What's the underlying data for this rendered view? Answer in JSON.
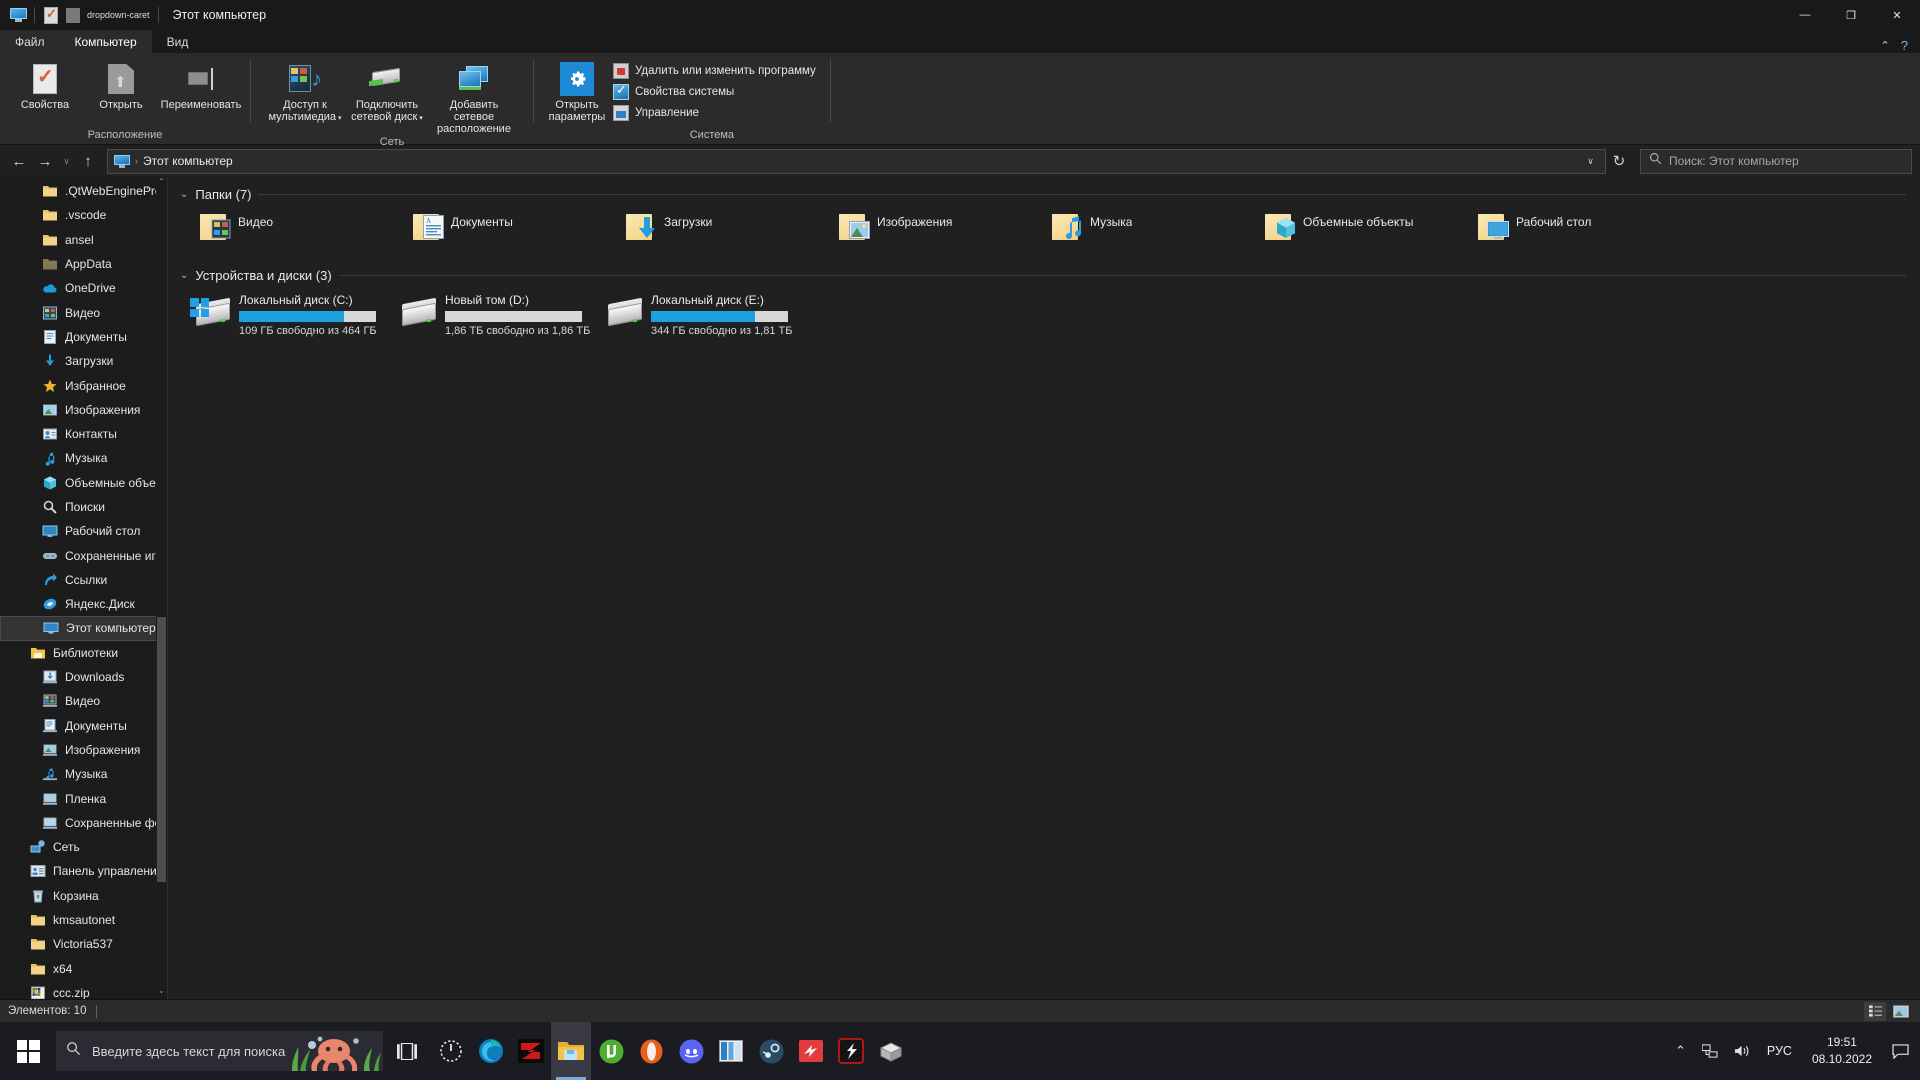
{
  "window": {
    "title": "Этот компьютер",
    "quick_access": [
      "this-pc-icon",
      "properties-icon",
      "grey-icon",
      "dropdown-caret"
    ],
    "controls": {
      "minimize": "—",
      "maximize": "❐",
      "close": "✕"
    }
  },
  "ribbon": {
    "tabs": [
      {
        "label": "Файл",
        "id": "file"
      },
      {
        "label": "Компьютер",
        "id": "computer",
        "active": true
      },
      {
        "label": "Вид",
        "id": "view"
      }
    ],
    "collapse_caret": "⌃",
    "help": "?",
    "groups": [
      {
        "label": "Расположение",
        "buttons": [
          {
            "label": "Свойства",
            "icon": "properties-icon",
            "has_dropdown": false
          },
          {
            "label": "Открыть",
            "icon": "open-icon",
            "has_dropdown": false
          },
          {
            "label": "Переименовать",
            "icon": "rename-icon",
            "has_dropdown": false
          }
        ]
      },
      {
        "label": "Сеть",
        "buttons": [
          {
            "label": "Доступ к мультимедиа",
            "icon": "media-server-icon",
            "has_dropdown": true
          },
          {
            "label": "Подключить сетевой диск",
            "icon": "map-network-drive-icon",
            "has_dropdown": true
          },
          {
            "label": "Добавить сетевое расположение",
            "icon": "add-network-location-icon",
            "has_dropdown": false
          }
        ]
      },
      {
        "label": "Система",
        "buttons": [
          {
            "label": "Открыть параметры",
            "icon": "settings-gear-icon",
            "has_dropdown": false
          }
        ],
        "small_buttons": [
          {
            "label": "Удалить или изменить программу",
            "icon": "uninstall-icon"
          },
          {
            "label": "Свойства системы",
            "icon": "system-properties-icon"
          },
          {
            "label": "Управление",
            "icon": "manage-icon"
          }
        ]
      }
    ]
  },
  "nav": {
    "back": "←",
    "forward": "→",
    "recent": "∨",
    "up": "↑",
    "address_icon": "this-pc-icon",
    "address_separator": "›",
    "address_text": "Этот компьютер",
    "address_dropdown": "∨",
    "refresh": "↻"
  },
  "search": {
    "icon": "search-icon",
    "placeholder": "Поиск: Этот компьютер",
    "value": ""
  },
  "sidebar": {
    "items": [
      {
        "label": ".QtWebEngineProc",
        "icon": "folder-icon",
        "indent": 1
      },
      {
        "label": ".vscode",
        "icon": "folder-icon",
        "indent": 1
      },
      {
        "label": "ansel",
        "icon": "folder-icon",
        "indent": 1
      },
      {
        "label": "AppData",
        "icon": "folder-hidden-icon",
        "indent": 1
      },
      {
        "label": "OneDrive",
        "icon": "onedrive-icon",
        "indent": 1
      },
      {
        "label": "Видео",
        "icon": "videos-icon",
        "indent": 1
      },
      {
        "label": "Документы",
        "icon": "documents-icon",
        "indent": 1
      },
      {
        "label": "Загрузки",
        "icon": "downloads-icon",
        "indent": 1
      },
      {
        "label": "Избранное",
        "icon": "favorites-star-icon",
        "indent": 1
      },
      {
        "label": "Изображения",
        "icon": "pictures-icon",
        "indent": 1
      },
      {
        "label": "Контакты",
        "icon": "contacts-icon",
        "indent": 1
      },
      {
        "label": "Музыка",
        "icon": "music-icon",
        "indent": 1
      },
      {
        "label": "Объемные объект",
        "icon": "3d-objects-icon",
        "indent": 1
      },
      {
        "label": "Поиски",
        "icon": "searches-icon",
        "indent": 1
      },
      {
        "label": "Рабочий стол",
        "icon": "desktop-icon",
        "indent": 1
      },
      {
        "label": "Сохраненные игр",
        "icon": "saved-games-icon",
        "indent": 1
      },
      {
        "label": "Ссылки",
        "icon": "links-icon",
        "indent": 1
      },
      {
        "label": "Яндекс.Диск",
        "icon": "yandex-disk-icon",
        "indent": 1
      },
      {
        "label": "Этот компьютер",
        "icon": "this-pc-icon",
        "indent": 1,
        "selected": true
      },
      {
        "label": "Библиотеки",
        "icon": "libraries-icon",
        "indent": 0
      },
      {
        "label": "Downloads",
        "icon": "library-downloads-icon",
        "indent": 1
      },
      {
        "label": "Видео",
        "icon": "library-videos-icon",
        "indent": 1
      },
      {
        "label": "Документы",
        "icon": "library-documents-icon",
        "indent": 1
      },
      {
        "label": "Изображения",
        "icon": "library-pictures-icon",
        "indent": 1
      },
      {
        "label": "Музыка",
        "icon": "library-music-icon",
        "indent": 1
      },
      {
        "label": "Пленка",
        "icon": "library-camera-roll-icon",
        "indent": 1
      },
      {
        "label": "Сохраненные фот",
        "icon": "library-saved-pictures-icon",
        "indent": 1
      },
      {
        "label": "Сеть",
        "icon": "network-icon",
        "indent": 0
      },
      {
        "label": "Панель управления",
        "icon": "control-panel-icon",
        "indent": 0
      },
      {
        "label": "Корзина",
        "icon": "recycle-bin-icon",
        "indent": 0
      },
      {
        "label": "kmsautonet",
        "icon": "folder-icon",
        "indent": 0
      },
      {
        "label": "Victoria537",
        "icon": "folder-icon",
        "indent": 0
      },
      {
        "label": "x64",
        "icon": "folder-icon",
        "indent": 0
      },
      {
        "label": "ccc.zip",
        "icon": "archive-icon",
        "indent": 0
      }
    ],
    "scroll_up": "⌃",
    "scroll_down": "⌄"
  },
  "main": {
    "groups": [
      {
        "title": "Папки (7)",
        "chevron": "⌄",
        "type": "folders",
        "items": [
          {
            "label": "Видео",
            "icon": "folder-videos-icon"
          },
          {
            "label": "Документы",
            "icon": "folder-documents-icon"
          },
          {
            "label": "Загрузки",
            "icon": "folder-downloads-icon"
          },
          {
            "label": "Изображения",
            "icon": "folder-pictures-icon"
          },
          {
            "label": "Музыка",
            "icon": "folder-music-icon"
          },
          {
            "label": "Объемные объекты",
            "icon": "folder-3d-objects-icon"
          },
          {
            "label": "Рабочий стол",
            "icon": "folder-desktop-icon"
          }
        ]
      },
      {
        "title": "Устройства и диски (3)",
        "chevron": "⌄",
        "type": "drives",
        "items": [
          {
            "label": "Локальный диск (C:)",
            "free_text": "109 ГБ свободно из 464 ГБ",
            "used_percent": 77,
            "icon": "windows-drive-icon",
            "bar_color": "#1e9fe0"
          },
          {
            "label": "Новый том (D:)",
            "free_text": "1,86 ТБ свободно из 1,86 ТБ",
            "used_percent": 0,
            "icon": "drive-icon",
            "bar_color": "#1e9fe0"
          },
          {
            "label": "Локальный диск (E:)",
            "free_text": "344 ГБ свободно из 1,81 ТБ",
            "used_percent": 76,
            "icon": "drive-icon",
            "bar_color": "#1e9fe0"
          }
        ]
      }
    ]
  },
  "status": {
    "items_label": "Элементов: 10",
    "views": [
      {
        "name": "details-view-button",
        "active": true
      },
      {
        "name": "large-icons-view-button",
        "active": false
      }
    ]
  },
  "taskbar": {
    "start": "start-button",
    "search_placeholder": "Введите здесь текст для поиска",
    "search_icon": "search-icon",
    "task_view": "task-view-button",
    "apps": [
      {
        "name": "app-gauge",
        "color": "#e8e8e8"
      },
      {
        "name": "app-edge",
        "color": "#2a9fd6"
      },
      {
        "name": "app-zona",
        "color": "#d01818"
      },
      {
        "name": "app-file-explorer",
        "color": "#f0b429",
        "active": true
      },
      {
        "name": "app-utorrent",
        "color": "#4caf2f"
      },
      {
        "name": "app-opera",
        "color": "#e8601c"
      },
      {
        "name": "app-discord",
        "color": "#5865f2"
      },
      {
        "name": "app-ms-app",
        "color": "#2f7fc4"
      },
      {
        "name": "app-steam",
        "color": "#4f7e9e"
      },
      {
        "name": "app-red-app",
        "color": "#e23c3c"
      },
      {
        "name": "app-game-launcher",
        "color": "#9b1c1c"
      },
      {
        "name": "app-winrar",
        "color": "#9e9e9e"
      }
    ],
    "tray": {
      "expand": "⌃",
      "network_icon": "network-tray-icon",
      "volume_icon": "volume-tray-icon",
      "language": "РУС",
      "time": "19:51",
      "date": "08.10.2022",
      "notifications": "notification-center-icon"
    }
  },
  "colors": {
    "accent": "#1e9fe0",
    "window_bg": "#202020",
    "ribbon_bg": "#2b2b2b",
    "sidebar_bg": "#1c1c1c",
    "taskbar_bg": "#1b1b22"
  }
}
